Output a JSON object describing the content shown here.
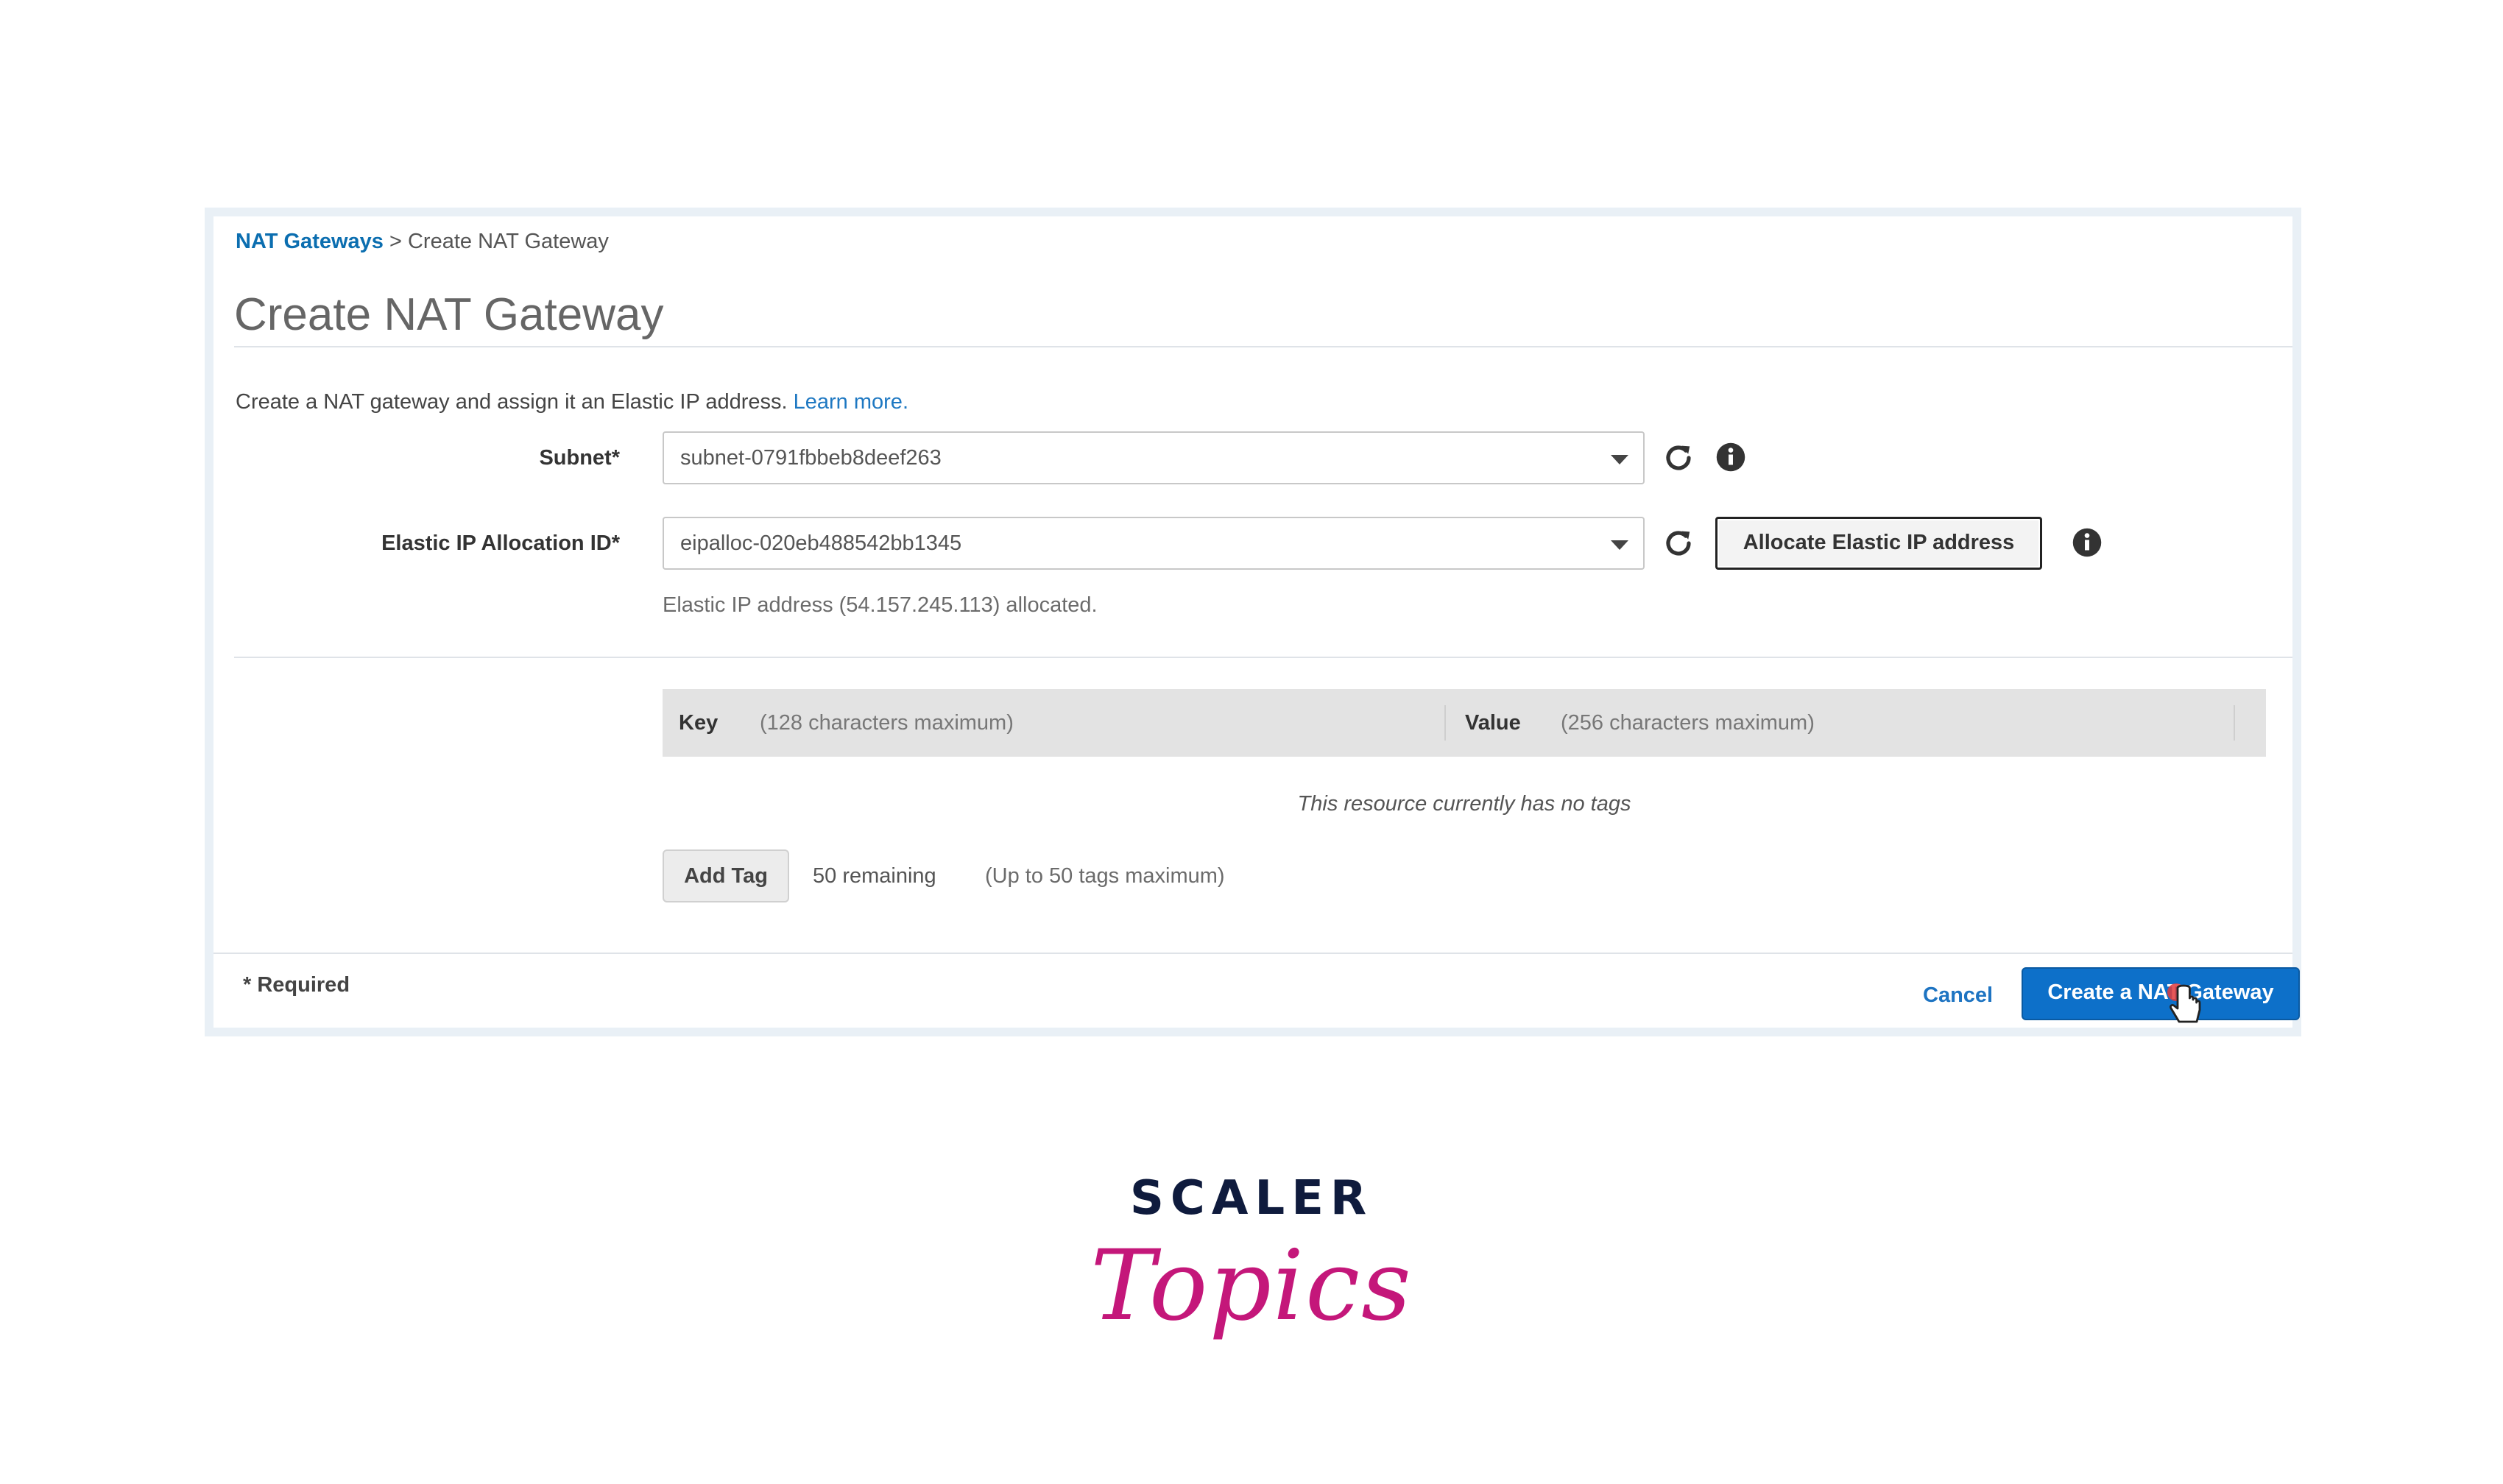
{
  "breadcrumb": {
    "parent": "NAT Gateways",
    "separator": ">",
    "current": "Create NAT Gateway"
  },
  "page_title": "Create NAT Gateway",
  "description": {
    "text": "Create a NAT gateway and assign it an Elastic IP address.",
    "link": "Learn more."
  },
  "subnet": {
    "label": "Subnet*",
    "value": "subnet-0791fbbeb8deef263"
  },
  "eip": {
    "label": "Elastic IP Allocation ID*",
    "value": "eipalloc-020eb488542bb1345",
    "allocate_label": "Allocate Elastic IP address",
    "status": "Elastic IP address (54.157.245.113) allocated."
  },
  "tags": {
    "key_label": "Key",
    "key_hint": "(128 characters maximum)",
    "value_label": "Value",
    "value_hint": "(256 characters maximum)",
    "empty": "This resource currently has no tags",
    "add_label": "Add Tag",
    "remaining": "50 remaining",
    "limit": "(Up to 50 tags maximum)"
  },
  "footer": {
    "required": "* Required",
    "cancel": "Cancel",
    "submit": "Create a NAT Gateway"
  },
  "brand": {
    "name_top": "SCALER",
    "name_bottom": "Topics"
  },
  "colors": {
    "link": "#0b6eb0",
    "primary": "#0d70c9",
    "brand_navy": "#0f1b3d",
    "brand_pink": "#c4177a"
  },
  "icons": {
    "refresh": "refresh-icon",
    "info": "info-icon",
    "caret": "chevron-down-icon",
    "cursor": "hand-cursor-icon"
  }
}
